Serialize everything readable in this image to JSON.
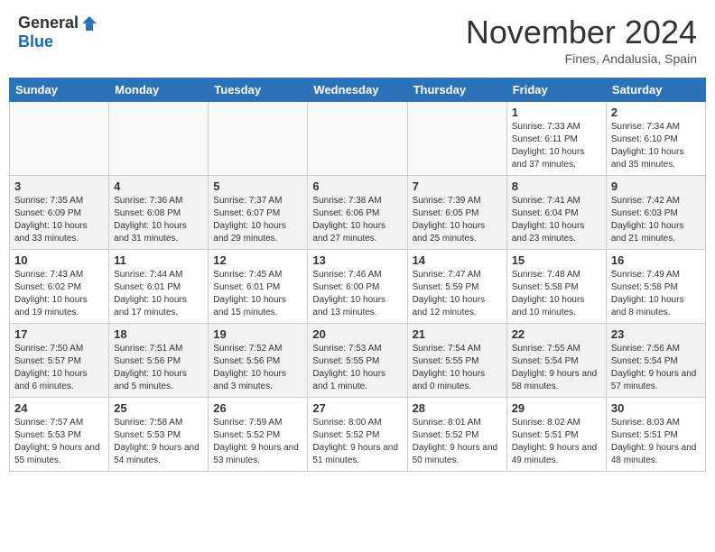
{
  "header": {
    "logo_general": "General",
    "logo_blue": "Blue",
    "month_title": "November 2024",
    "location": "Fines, Andalusia, Spain"
  },
  "calendar": {
    "headers": [
      "Sunday",
      "Monday",
      "Tuesday",
      "Wednesday",
      "Thursday",
      "Friday",
      "Saturday"
    ],
    "weeks": [
      {
        "stripe": false,
        "days": [
          {
            "num": "",
            "info": ""
          },
          {
            "num": "",
            "info": ""
          },
          {
            "num": "",
            "info": ""
          },
          {
            "num": "",
            "info": ""
          },
          {
            "num": "",
            "info": ""
          },
          {
            "num": "1",
            "info": "Sunrise: 7:33 AM\nSunset: 6:11 PM\nDaylight: 10 hours and 37 minutes."
          },
          {
            "num": "2",
            "info": "Sunrise: 7:34 AM\nSunset: 6:10 PM\nDaylight: 10 hours and 35 minutes."
          }
        ]
      },
      {
        "stripe": true,
        "days": [
          {
            "num": "3",
            "info": "Sunrise: 7:35 AM\nSunset: 6:09 PM\nDaylight: 10 hours and 33 minutes."
          },
          {
            "num": "4",
            "info": "Sunrise: 7:36 AM\nSunset: 6:08 PM\nDaylight: 10 hours and 31 minutes."
          },
          {
            "num": "5",
            "info": "Sunrise: 7:37 AM\nSunset: 6:07 PM\nDaylight: 10 hours and 29 minutes."
          },
          {
            "num": "6",
            "info": "Sunrise: 7:38 AM\nSunset: 6:06 PM\nDaylight: 10 hours and 27 minutes."
          },
          {
            "num": "7",
            "info": "Sunrise: 7:39 AM\nSunset: 6:05 PM\nDaylight: 10 hours and 25 minutes."
          },
          {
            "num": "8",
            "info": "Sunrise: 7:41 AM\nSunset: 6:04 PM\nDaylight: 10 hours and 23 minutes."
          },
          {
            "num": "9",
            "info": "Sunrise: 7:42 AM\nSunset: 6:03 PM\nDaylight: 10 hours and 21 minutes."
          }
        ]
      },
      {
        "stripe": false,
        "days": [
          {
            "num": "10",
            "info": "Sunrise: 7:43 AM\nSunset: 6:02 PM\nDaylight: 10 hours and 19 minutes."
          },
          {
            "num": "11",
            "info": "Sunrise: 7:44 AM\nSunset: 6:01 PM\nDaylight: 10 hours and 17 minutes."
          },
          {
            "num": "12",
            "info": "Sunrise: 7:45 AM\nSunset: 6:01 PM\nDaylight: 10 hours and 15 minutes."
          },
          {
            "num": "13",
            "info": "Sunrise: 7:46 AM\nSunset: 6:00 PM\nDaylight: 10 hours and 13 minutes."
          },
          {
            "num": "14",
            "info": "Sunrise: 7:47 AM\nSunset: 5:59 PM\nDaylight: 10 hours and 12 minutes."
          },
          {
            "num": "15",
            "info": "Sunrise: 7:48 AM\nSunset: 5:58 PM\nDaylight: 10 hours and 10 minutes."
          },
          {
            "num": "16",
            "info": "Sunrise: 7:49 AM\nSunset: 5:58 PM\nDaylight: 10 hours and 8 minutes."
          }
        ]
      },
      {
        "stripe": true,
        "days": [
          {
            "num": "17",
            "info": "Sunrise: 7:50 AM\nSunset: 5:57 PM\nDaylight: 10 hours and 6 minutes."
          },
          {
            "num": "18",
            "info": "Sunrise: 7:51 AM\nSunset: 5:56 PM\nDaylight: 10 hours and 5 minutes."
          },
          {
            "num": "19",
            "info": "Sunrise: 7:52 AM\nSunset: 5:56 PM\nDaylight: 10 hours and 3 minutes."
          },
          {
            "num": "20",
            "info": "Sunrise: 7:53 AM\nSunset: 5:55 PM\nDaylight: 10 hours and 1 minute."
          },
          {
            "num": "21",
            "info": "Sunrise: 7:54 AM\nSunset: 5:55 PM\nDaylight: 10 hours and 0 minutes."
          },
          {
            "num": "22",
            "info": "Sunrise: 7:55 AM\nSunset: 5:54 PM\nDaylight: 9 hours and 58 minutes."
          },
          {
            "num": "23",
            "info": "Sunrise: 7:56 AM\nSunset: 5:54 PM\nDaylight: 9 hours and 57 minutes."
          }
        ]
      },
      {
        "stripe": false,
        "days": [
          {
            "num": "24",
            "info": "Sunrise: 7:57 AM\nSunset: 5:53 PM\nDaylight: 9 hours and 55 minutes."
          },
          {
            "num": "25",
            "info": "Sunrise: 7:58 AM\nSunset: 5:53 PM\nDaylight: 9 hours and 54 minutes."
          },
          {
            "num": "26",
            "info": "Sunrise: 7:59 AM\nSunset: 5:52 PM\nDaylight: 9 hours and 53 minutes."
          },
          {
            "num": "27",
            "info": "Sunrise: 8:00 AM\nSunset: 5:52 PM\nDaylight: 9 hours and 51 minutes."
          },
          {
            "num": "28",
            "info": "Sunrise: 8:01 AM\nSunset: 5:52 PM\nDaylight: 9 hours and 50 minutes."
          },
          {
            "num": "29",
            "info": "Sunrise: 8:02 AM\nSunset: 5:51 PM\nDaylight: 9 hours and 49 minutes."
          },
          {
            "num": "30",
            "info": "Sunrise: 8:03 AM\nSunset: 5:51 PM\nDaylight: 9 hours and 48 minutes."
          }
        ]
      }
    ]
  }
}
